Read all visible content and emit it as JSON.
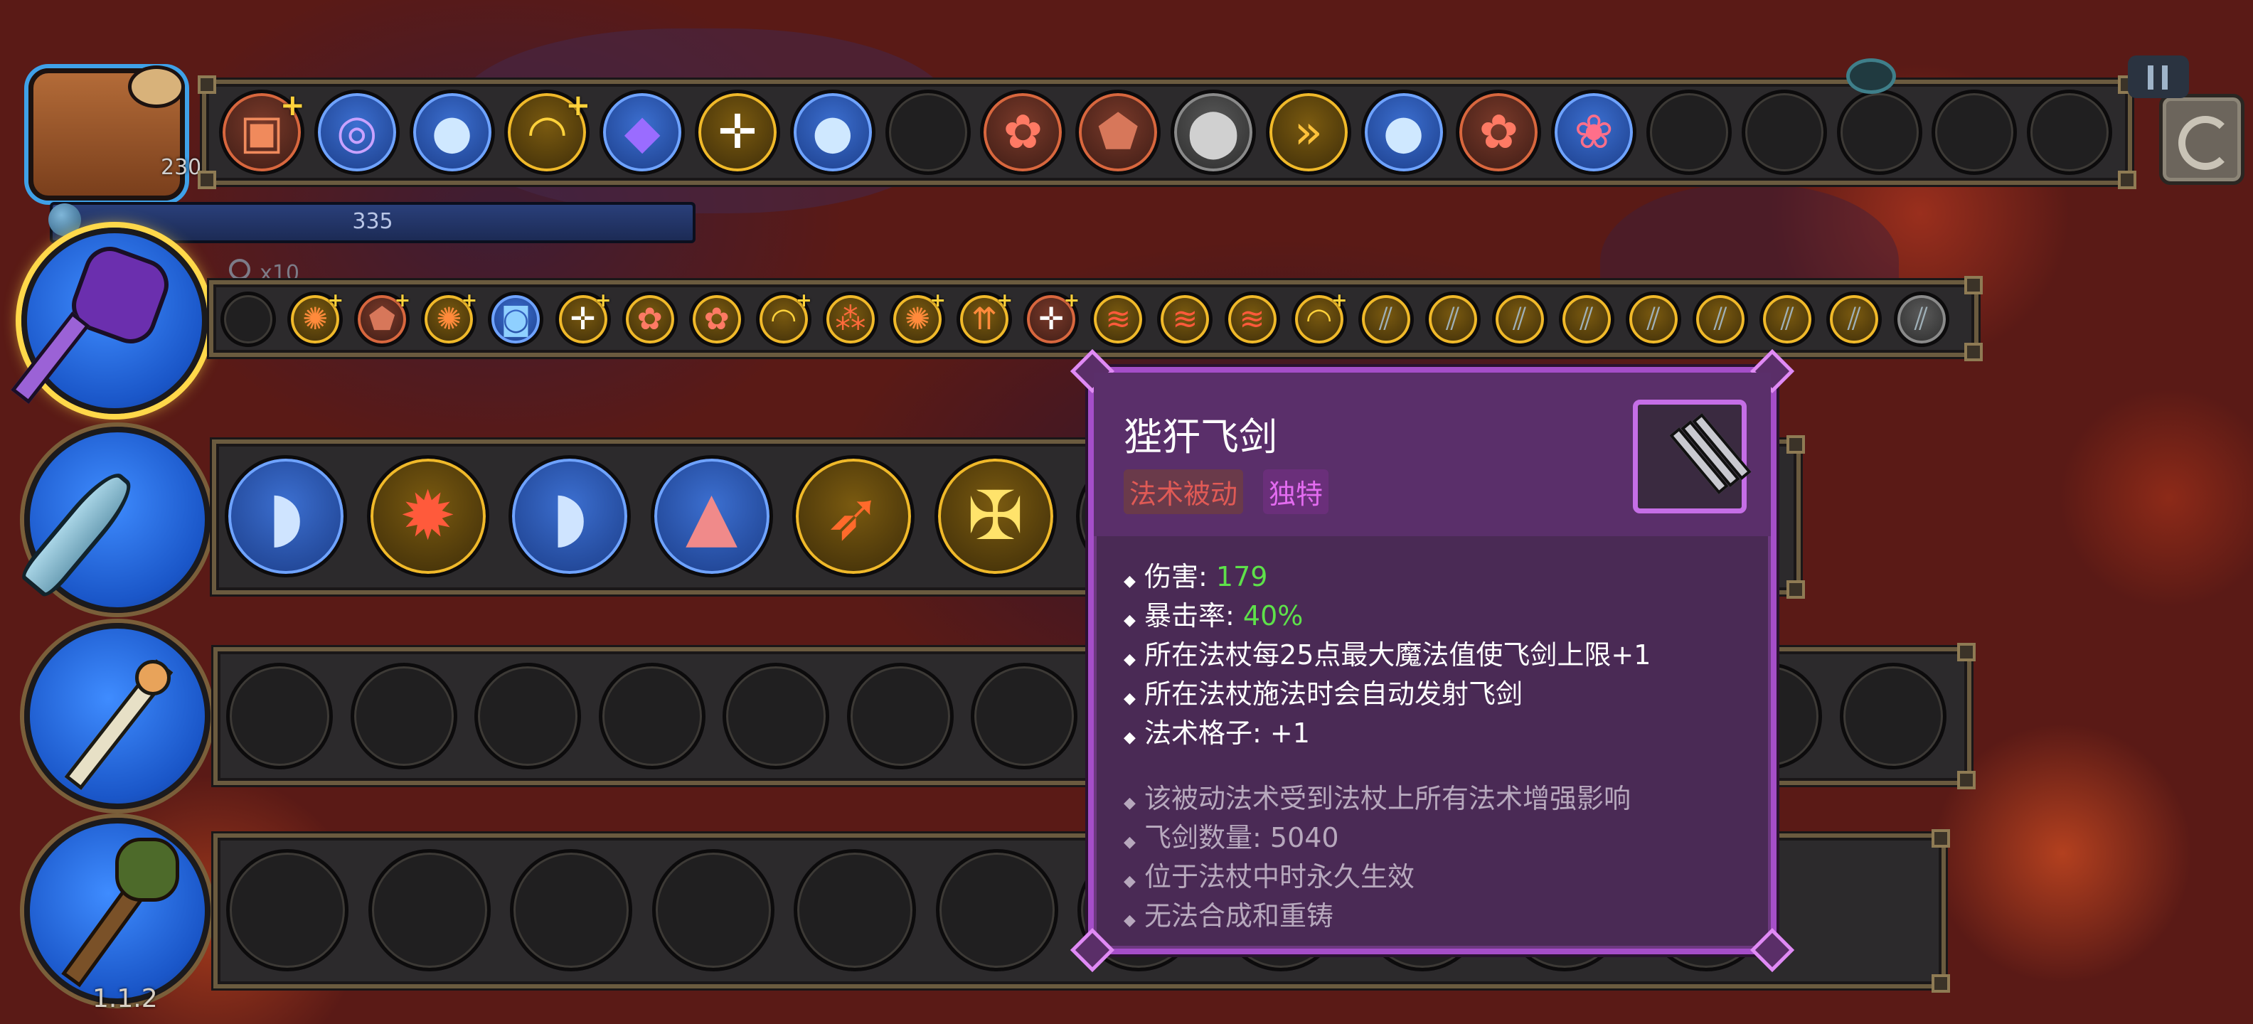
{
  "hud": {
    "bag_count": "230",
    "mana_value": "335",
    "zoom_label": "x10",
    "version": "1.1.2"
  },
  "colors": {
    "tooltip_bg": "#4a2a55",
    "tooltip_border": "#a54ec9",
    "stat_value_green": "#5ee14a",
    "tag_red": "#e05a55",
    "tag_magenta": "#e36bf0"
  },
  "top_bar": {
    "slots": [
      {
        "icon": "treasure-box-icon",
        "style": "red",
        "plus": true
      },
      {
        "icon": "spiral-vortex-icon",
        "style": "blue",
        "plus": false
      },
      {
        "icon": "frost-orb-icon",
        "style": "blue",
        "plus": false
      },
      {
        "icon": "boomerang-arc-icon",
        "style": "gold",
        "plus": true
      },
      {
        "icon": "crystal-gem-icon",
        "style": "blue",
        "plus": false
      },
      {
        "icon": "target-crosshair-icon",
        "style": "gold",
        "plus": false
      },
      {
        "icon": "frost-orb-icon",
        "style": "blue",
        "plus": false
      },
      {
        "icon": "empty-slot",
        "style": "empty",
        "plus": false
      },
      {
        "icon": "fire-flower-icon",
        "style": "red",
        "plus": false
      },
      {
        "icon": "rock-shard-icon",
        "style": "red",
        "plus": false
      },
      {
        "icon": "stone-ball-icon",
        "style": "grey",
        "plus": false
      },
      {
        "icon": "speed-chevrons-icon",
        "style": "gold",
        "plus": false
      },
      {
        "icon": "frost-orb-icon",
        "style": "blue",
        "plus": false
      },
      {
        "icon": "fire-flower-icon",
        "style": "red",
        "plus": false
      },
      {
        "icon": "pink-creature-icon",
        "style": "blue",
        "plus": false
      },
      {
        "icon": "empty-slot",
        "style": "empty",
        "plus": false
      },
      {
        "icon": "empty-slot",
        "style": "empty",
        "plus": false
      },
      {
        "icon": "empty-slot",
        "style": "empty",
        "plus": false
      },
      {
        "icon": "empty-slot",
        "style": "empty",
        "plus": false
      },
      {
        "icon": "empty-slot",
        "style": "empty",
        "plus": false
      }
    ]
  },
  "wand1_bar": {
    "slots": [
      {
        "icon": "empty-slot",
        "style": "empty",
        "plus": false
      },
      {
        "icon": "flame-burst-icon",
        "style": "gold",
        "plus": true
      },
      {
        "icon": "rock-shard-icon",
        "style": "red",
        "plus": true
      },
      {
        "icon": "flame-burst-icon",
        "style": "gold",
        "plus": true
      },
      {
        "icon": "spiral-square-icon",
        "style": "blue",
        "plus": false
      },
      {
        "icon": "target-crosshair-icon",
        "style": "gold",
        "plus": true
      },
      {
        "icon": "fire-flower-icon",
        "style": "gold",
        "plus": false
      },
      {
        "icon": "fire-flower-icon",
        "style": "gold",
        "plus": false
      },
      {
        "icon": "boomerang-arc-icon",
        "style": "gold",
        "plus": true
      },
      {
        "icon": "triple-split-icon",
        "style": "gold",
        "plus": false
      },
      {
        "icon": "flame-burst-icon",
        "style": "gold",
        "plus": true
      },
      {
        "icon": "arrows-up-icon",
        "style": "gold",
        "plus": true
      },
      {
        "icon": "target-crosshair-icon",
        "style": "red",
        "plus": true
      },
      {
        "icon": "claw-slash-icon",
        "style": "gold",
        "plus": false
      },
      {
        "icon": "claw-slash-icon",
        "style": "gold",
        "plus": false
      },
      {
        "icon": "claw-slash-icon",
        "style": "gold",
        "plus": false
      },
      {
        "icon": "boomerang-arc-icon",
        "style": "gold",
        "plus": true
      },
      {
        "icon": "flying-swords-icon",
        "style": "gold",
        "plus": false
      },
      {
        "icon": "flying-swords-icon",
        "style": "gold",
        "plus": false
      },
      {
        "icon": "flying-swords-icon",
        "style": "gold",
        "plus": false
      },
      {
        "icon": "flying-swords-icon",
        "style": "gold",
        "plus": false
      },
      {
        "icon": "flying-swords-icon",
        "style": "gold",
        "plus": false
      },
      {
        "icon": "flying-swords-icon",
        "style": "gold",
        "plus": false
      },
      {
        "icon": "flying-swords-icon",
        "style": "gold",
        "plus": false
      },
      {
        "icon": "flying-swords-icon",
        "style": "gold",
        "plus": false
      },
      {
        "icon": "flying-swords-icon",
        "style": "grey",
        "plus": false
      }
    ]
  },
  "wand2_bar": {
    "slots": [
      {
        "icon": "water-wave-icon",
        "style": "blue"
      },
      {
        "icon": "explosion-burst-icon",
        "style": "gold"
      },
      {
        "icon": "water-wave-icon",
        "style": "blue"
      },
      {
        "icon": "horn-spike-icon",
        "style": "blue"
      },
      {
        "icon": "fire-arrow-icon",
        "style": "gold"
      },
      {
        "icon": "holy-cross-icon",
        "style": "gold"
      }
    ]
  },
  "tooltip": {
    "title": "狴犴飞剑",
    "icon": "flying-swords-icon",
    "tags": [
      "法术被动",
      "独特"
    ],
    "stats": [
      {
        "label": "伤害: ",
        "value": "179"
      },
      {
        "label": "暴击率: ",
        "value": "40%"
      },
      {
        "label": "所在法杖每25点最大魔法值使飞剑上限+1",
        "value": ""
      },
      {
        "label": "所在法杖施法时会自动发射飞剑",
        "value": ""
      },
      {
        "label": "法术格子: +1",
        "value": ""
      }
    ],
    "notes": [
      "该被动法术受到法杖上所有法术增强影响",
      "飞剑数量: 5040",
      "位于法杖中时永久生效",
      "无法合成和重铸"
    ]
  }
}
